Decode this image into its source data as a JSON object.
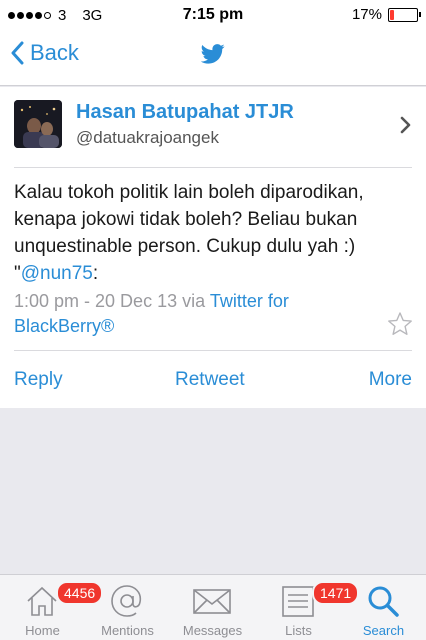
{
  "status_bar": {
    "carrier": "3",
    "network": "3G",
    "time": "7:15 pm",
    "battery": "17%",
    "battery_level": 0.17,
    "battery_color": "#ff3b30"
  },
  "nav": {
    "back_label": "Back",
    "center_icon": "twitter-bird-icon"
  },
  "tweet": {
    "author_name": "Hasan Batupahat JTJR",
    "author_handle": "@datuakrajoangek",
    "text": "Kalau tokoh politik lain boleh diparodikan, kenapa jokowi tidak boleh? Beliau bukan unquestinable person. Cukup dulu yah :) \"",
    "mention": "@nun75",
    "text_tail": ":",
    "timestamp": "1:00 pm - 20 Dec 13",
    "via": "via",
    "source": "Twitter for BlackBerry®"
  },
  "actions": {
    "reply": "Reply",
    "retweet": "Retweet",
    "more": "More"
  },
  "tabs": [
    {
      "label": "Home",
      "icon": "home-icon",
      "badge": "4456"
    },
    {
      "label": "Mentions",
      "icon": "at-icon"
    },
    {
      "label": "Messages",
      "icon": "envelope-icon"
    },
    {
      "label": "Lists",
      "icon": "list-icon",
      "badge": "1471"
    },
    {
      "label": "Search",
      "icon": "search-icon",
      "active": true
    }
  ],
  "colors": {
    "accent": "#2a8dd6",
    "badge": "#f0362d"
  }
}
